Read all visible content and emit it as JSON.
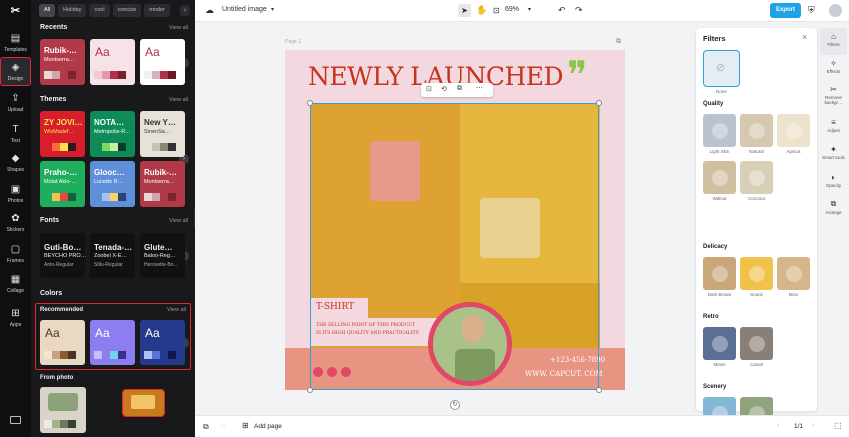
{
  "rail": {
    "items": [
      {
        "label": "Templates",
        "icon": "templates-icon",
        "glyph": "▤"
      },
      {
        "label": "Design",
        "icon": "design-icon",
        "glyph": "◈"
      },
      {
        "label": "Upload",
        "icon": "upload-icon",
        "glyph": "⇪"
      },
      {
        "label": "Text",
        "icon": "text-icon",
        "glyph": "T"
      },
      {
        "label": "Shapes",
        "icon": "shapes-icon",
        "glyph": "◆"
      },
      {
        "label": "Photos",
        "icon": "photos-icon",
        "glyph": "▣"
      },
      {
        "label": "Stickers",
        "icon": "stickers-icon",
        "glyph": "✿"
      },
      {
        "label": "Frames",
        "icon": "frames-icon",
        "glyph": "▢"
      },
      {
        "label": "Collage",
        "icon": "collage-icon",
        "glyph": "▦"
      },
      {
        "label": "Apps",
        "icon": "apps-icon",
        "glyph": "⊞"
      }
    ]
  },
  "panel": {
    "chips": [
      "All",
      "Holiday",
      "cool",
      "concise",
      "moder"
    ],
    "view_all": "View all",
    "recents": {
      "title": "Recents",
      "cards": [
        {
          "t1": "Rubik-…",
          "t2": "Montserra…",
          "bg": "#b03a48",
          "fg": "#fff",
          "sw": [
            "#e8d7d9",
            "#cfa7ad",
            "#b03a48",
            "#7a2430"
          ]
        },
        {
          "aa": "Aa",
          "bg": "#f6e3e8",
          "fg": "#b0314a",
          "sw": [
            "#f0c9d2",
            "#e19aab",
            "#b0314a",
            "#7a1e30"
          ]
        },
        {
          "aa": "Aa",
          "bg": "#ffffff",
          "fg": "#b0314a",
          "sw": [
            "#f0f0f0",
            "#d9b0b8",
            "#b0314a",
            "#6a1a26"
          ]
        }
      ]
    },
    "themes": {
      "title": "Themes",
      "cards": [
        {
          "t1": "ZY JOVI…",
          "t2": "WixMadef…",
          "bg": "#d81e2b",
          "fg": "#ffe14d",
          "sw": [
            "#d81e2b",
            "#ff6a3d",
            "#ffe14d",
            "#2a1a1a"
          ]
        },
        {
          "t1": "NOTA…",
          "t2": "Metropolis-R…",
          "bg": "#0d8c5a",
          "fg": "#fff",
          "sw": [
            "#0d8c5a",
            "#7ed957",
            "#c7f0a0",
            "#0a3b26"
          ]
        },
        {
          "t1": "New Y…",
          "t2": "SinenSa…",
          "bg": "#e7e2d8",
          "fg": "#333",
          "sw": [
            "#e7e2d8",
            "#c8c2b6",
            "#8c8678",
            "#333"
          ]
        },
        {
          "t1": "Praho-…",
          "t2": "Molat Aklo-…",
          "bg": "#1fae5e",
          "fg": "#fff",
          "sw": [
            "#1fae5e",
            "#f2c14e",
            "#e5483c",
            "#12613a"
          ]
        },
        {
          "t1": "Glooc…",
          "t2": "Lucette R…",
          "bg": "#5e8fd8",
          "fg": "#fff",
          "sw": [
            "#5e8fd8",
            "#a6c3ef",
            "#f6d36b",
            "#28427a"
          ]
        },
        {
          "t1": "Rubik-…",
          "t2": "Montserra…",
          "bg": "#b03a48",
          "fg": "#fff",
          "sw": [
            "#e8d7d9",
            "#cfa7ad",
            "#b03a48",
            "#7a2430"
          ]
        }
      ]
    },
    "fonts": {
      "title": "Fonts",
      "cards": [
        {
          "f1": "Guti-Bo…",
          "f2": "BEYCHO PRO…",
          "f3": "Anto-Regular"
        },
        {
          "f1": "Tenada-…",
          "f2": "Zoobel X-E…",
          "f3": "Stilu-Regular"
        },
        {
          "f1": "Glute…",
          "f2": "Baloo-Reg…",
          "f3": "Herosette-Bo…"
        }
      ]
    },
    "colors": {
      "title": "Colors",
      "recommended": "Recommended",
      "cards": [
        {
          "aa": "Aa",
          "bg": "#ead9c2",
          "fg": "#4a3424",
          "sw": [
            "#f3e4cc",
            "#c9a27b",
            "#8a5a35",
            "#4a3424"
          ]
        },
        {
          "aa": "Aa",
          "bg": "#8c7ef0",
          "fg": "#fff",
          "sw": [
            "#c7bff8",
            "#8c7ef0",
            "#6bd6e6",
            "#3a2f8c"
          ]
        },
        {
          "aa": "Aa",
          "bg": "#253a8c",
          "fg": "#fff",
          "sw": [
            "#a9c4f2",
            "#5677d8",
            "#253a8c",
            "#0f1a4a"
          ]
        }
      ]
    },
    "from_photo": "From photo"
  },
  "topbar": {
    "title": "Untitled image",
    "zoom": "69%",
    "export": "Export"
  },
  "page_label": "Page 1",
  "poster": {
    "headline": "NEWLY LAUNCHED",
    "quote": "❞",
    "tag": "T-SHIRT",
    "desc1": "THE SELLING POINT OF THIS PRODUCT",
    "desc2": "IS ITS HIGH QUALITY AND PRACTICALITY.",
    "phone": "+123-456-7890",
    "web": "WWW. CAPCUT. COM"
  },
  "filters": {
    "title": "Filters",
    "none": "None",
    "groups": [
      {
        "title": "Quality",
        "items": [
          {
            "label": "Light Skin",
            "color": "#b9c3cf"
          },
          {
            "label": "Natural",
            "color": "#d6c7b0"
          },
          {
            "label": "Apricot",
            "color": "#ede2cb"
          },
          {
            "label": "Walnut",
            "color": "#cfc0a2"
          },
          {
            "label": "Coconut",
            "color": "#d8cfb8"
          }
        ]
      },
      {
        "title": "Delicacy",
        "items": [
          {
            "label": "Dark Brown",
            "color": "#c9a77a"
          },
          {
            "label": "Snack",
            "color": "#f0c24a"
          },
          {
            "label": "Miso",
            "color": "#d7b58a"
          }
        ]
      },
      {
        "title": "Retro",
        "items": [
          {
            "label": "Miami",
            "color": "#5a6e96"
          },
          {
            "label": "Camel",
            "color": "#8a7f76"
          }
        ]
      },
      {
        "title": "Scenery",
        "items": [
          {
            "label": "Jasmine Tea",
            "color": "#86b6d6"
          },
          {
            "label": "Selfie",
            "color": "#8fa47d"
          }
        ]
      }
    ]
  },
  "right_tools": [
    {
      "label": "Filters",
      "glyph": "⌂"
    },
    {
      "label": "Effects",
      "glyph": "✧"
    },
    {
      "label": "Remove backgr…",
      "glyph": "✂"
    },
    {
      "label": "Adjust",
      "glyph": "≡"
    },
    {
      "label": "Smart tools",
      "glyph": "✦"
    },
    {
      "label": "Opacity",
      "glyph": "◐"
    },
    {
      "label": "Arrange",
      "glyph": "⧉"
    }
  ],
  "bottombar": {
    "add_page": "Add page",
    "page_counter": "1/1"
  }
}
